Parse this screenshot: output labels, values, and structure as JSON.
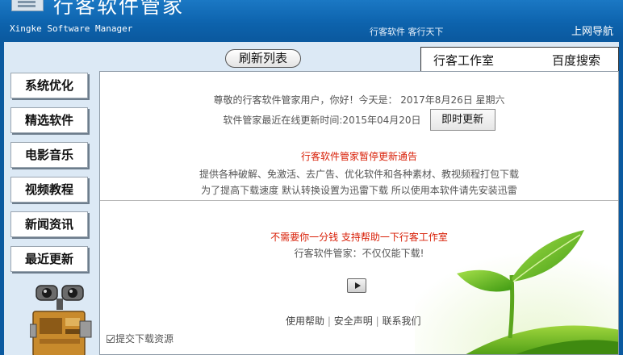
{
  "header": {
    "title": "行客软件管家",
    "subtitle": "Xingke Software Manager",
    "slogan": "行客软件 客行天下",
    "nav_link": "上网导航"
  },
  "toolbar": {
    "refresh_label": "刷新列表",
    "tabs": [
      {
        "label": "行客工作室"
      },
      {
        "label": "百度搜索"
      }
    ]
  },
  "sidebar": {
    "items": [
      {
        "label": "系统优化"
      },
      {
        "label": "精选软件"
      },
      {
        "label": "电影音乐"
      },
      {
        "label": "视频教程"
      },
      {
        "label": "新闻资讯"
      },
      {
        "label": "最近更新"
      }
    ]
  },
  "main": {
    "greeting": "尊敬的行客软件管家用户，你好！今天是： 2017年8月26日 星期六",
    "update_text": "软件管家最近在线更新时间:2015年04月20日",
    "update_button": "即时更新",
    "notice_title": "行客软件管家暂停更新通告",
    "notice_line1": "提供各种破解、免激活、去广告、优化软件和各种素材、教视频程打包下载",
    "notice_line2": "为了提高下载速度 默认转换设置为迅雷下载 所以使用本软件请先安装迅雷",
    "support_text": "不需要你一分钱 支持帮助一下行客工作室",
    "tagline": "行客软件管家：不仅仅能下载!",
    "footer_links": [
      "使用帮助",
      "安全声明",
      "联系我们"
    ],
    "footer_sep": "|",
    "submit_label": "提交下载资源"
  },
  "colors": {
    "header_blue": "#0d63ad",
    "notice_red": "#d81e06",
    "panel_bg": "#dce9f5"
  },
  "icons": [
    "app-logo-icon",
    "play-icon",
    "checkbox-icon",
    "robot-mascot",
    "sprout-illustration"
  ]
}
